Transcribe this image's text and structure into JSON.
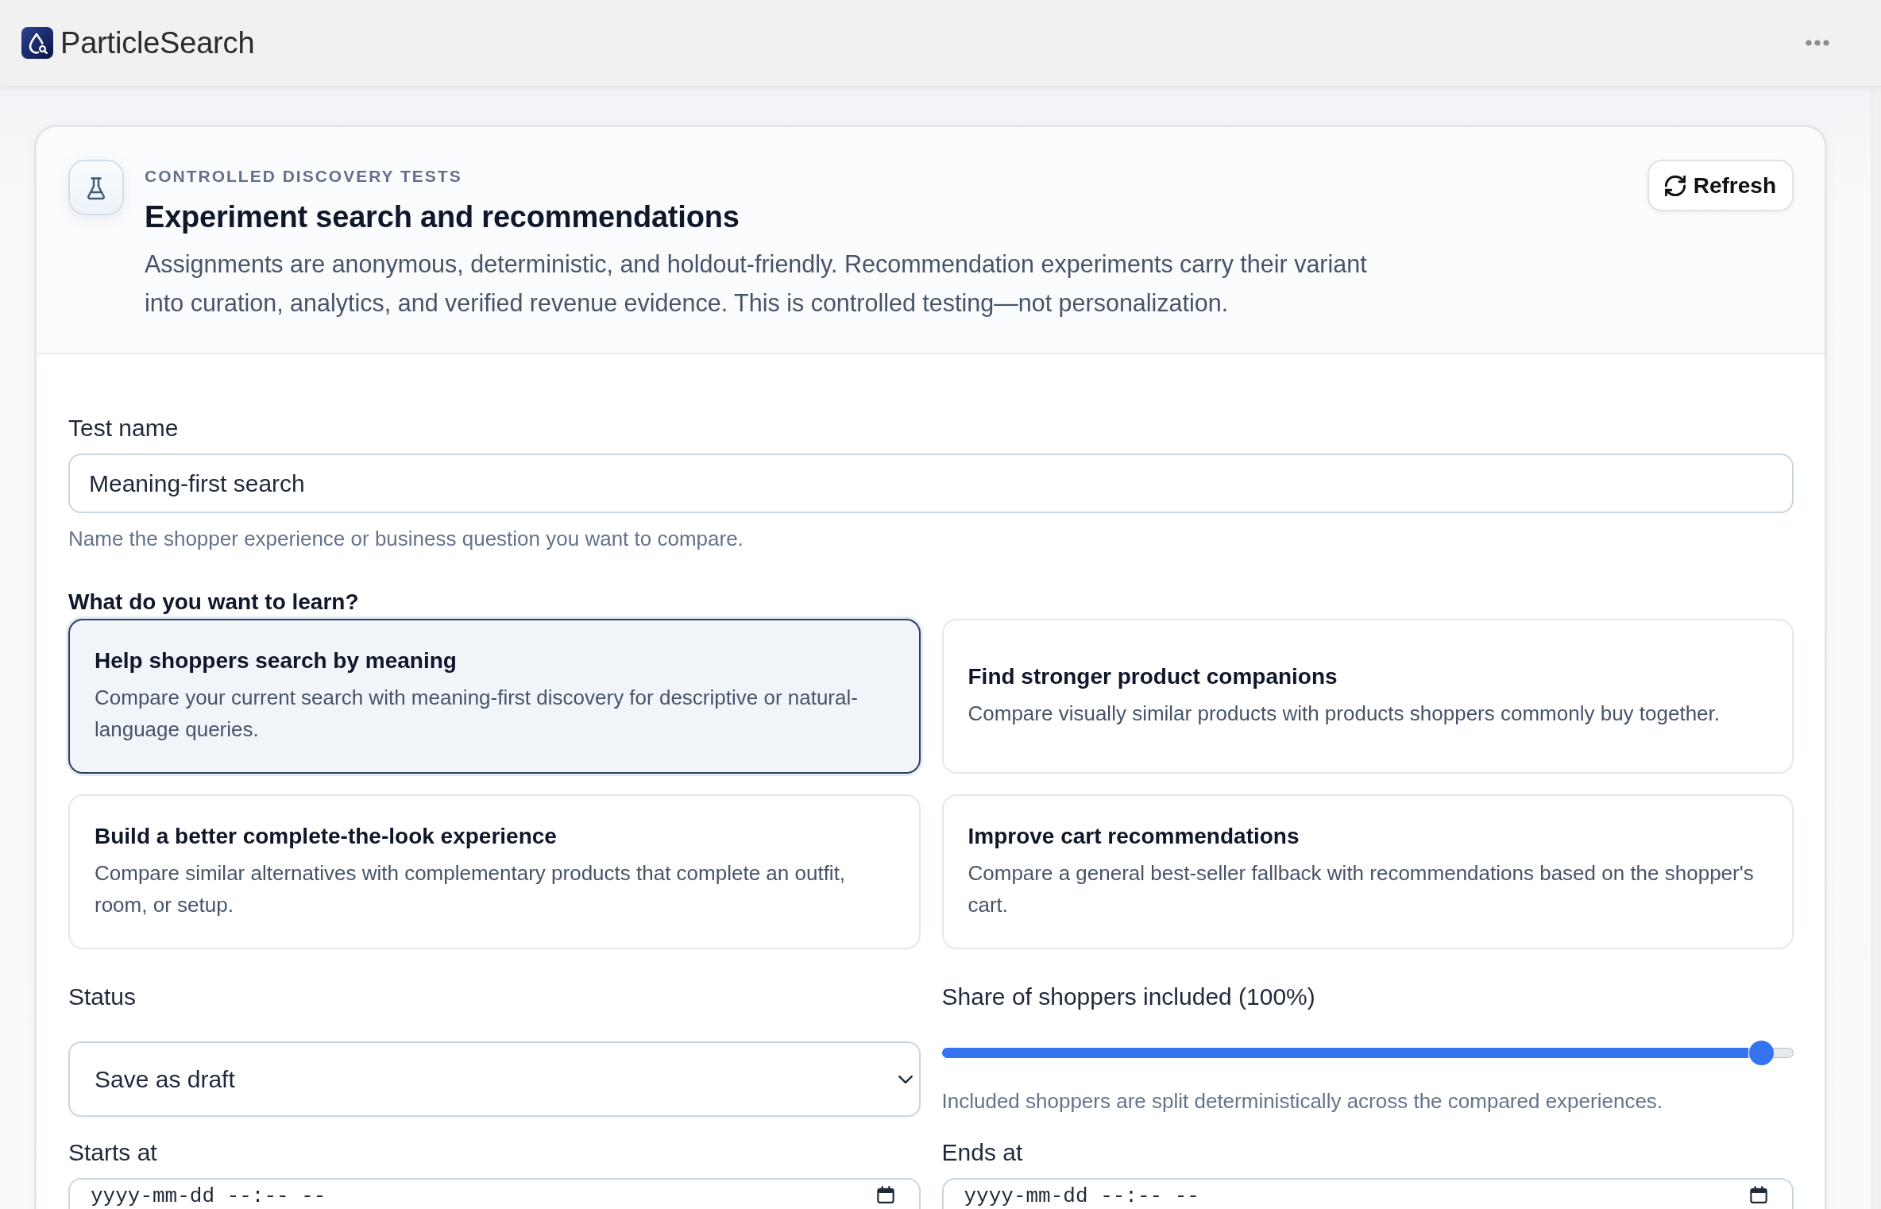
{
  "app_bar": {
    "title": "ParticleSearch"
  },
  "experiments": {
    "eyebrow": "CONTROLLED DISCOVERY TESTS",
    "title": "Experiment search and recommendations",
    "description": "Assignments are anonymous, deterministic, and holdout-friendly. Recommendation experiments carry their variant into curation, analytics, and verified revenue evidence. This is controlled testing—not personalization.",
    "refresh_button": "Refresh",
    "form": {
      "test_name": {
        "label": "Test name",
        "value": "Meaning-first search",
        "hint": "Name the shopper experience or business question you want to compare."
      },
      "goal": {
        "label": "What do you want to learn?",
        "options": [
          {
            "title": "Help shoppers search by meaning",
            "description": "Compare your current search with meaning-first discovery for descriptive or natural-language queries.",
            "selected": true
          },
          {
            "title": "Find stronger product companions",
            "description": "Compare visually similar products with products shoppers commonly buy together.",
            "selected": false
          },
          {
            "title": "Build a better complete-the-look experience",
            "description": "Compare similar alternatives with complementary products that complete an outfit, room, or setup.",
            "selected": false
          },
          {
            "title": "Improve cart recommendations",
            "description": "Compare a general best-seller fallback with recommendations based on the shopper's cart.",
            "selected": false
          }
        ]
      },
      "status": {
        "label": "Status",
        "value": "Save as draft"
      },
      "share": {
        "label": "Share of shoppers included (100%)",
        "level": 1,
        "hint": "Included shoppers are split deterministically across the compared experiences."
      },
      "starts_at": {
        "label": "Starts at",
        "placeholder": "yyyy-mm-dd --:-- --"
      },
      "ends_at": {
        "label": "Ends at",
        "placeholder": "yyyy-mm-dd --:-- --"
      }
    }
  }
}
